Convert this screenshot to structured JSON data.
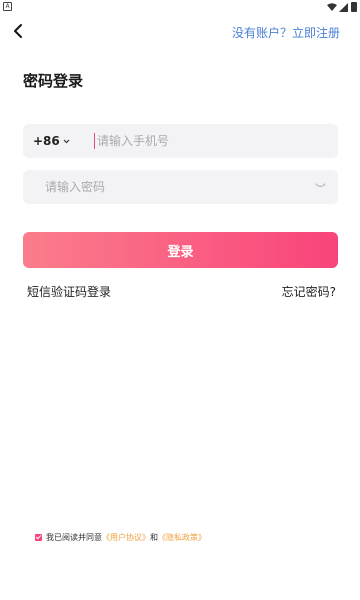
{
  "status_bar": {
    "app_icon_text": "A"
  },
  "header": {
    "register_prompt": "没有账户？立即注册"
  },
  "page": {
    "title": "密码登录"
  },
  "form": {
    "country_code": "+86",
    "phone_placeholder": "请输入手机号",
    "password_placeholder": "请输入密码",
    "login_label": "登录",
    "sms_login_label": "短信验证码登录",
    "forgot_password_label": "忘记密码?"
  },
  "agreement": {
    "prefix": "我已阅读并同意",
    "user_agreement": "《用户协议》",
    "conjunction": "和",
    "privacy_policy": "《隐私政策》",
    "checked": true
  },
  "colors": {
    "accent_gradient_start": "#fb7d8c",
    "accent_gradient_end": "#f9447a",
    "link_blue": "#4a7fd6",
    "link_orange": "#f0a040"
  }
}
